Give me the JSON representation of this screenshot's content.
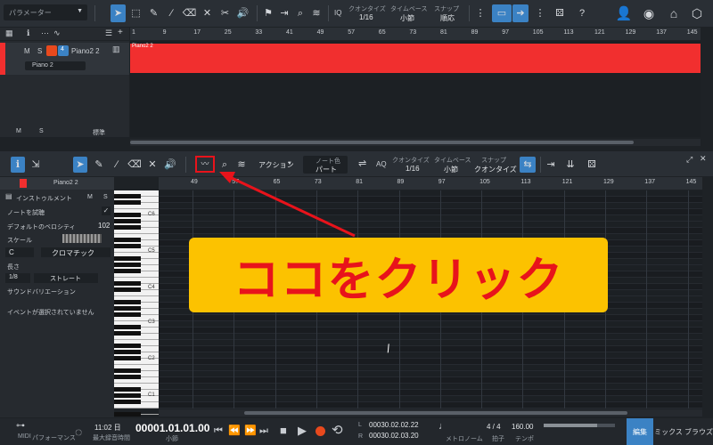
{
  "toolbar": {
    "params_label": "パラメーター",
    "quantize_label": "クオンタイズ",
    "quantize_value": "1/16",
    "timebase_label": "タイムベース",
    "timebase_value": "小節",
    "snap_label": "スナップ",
    "snap_value": "順応",
    "iq": "IQ",
    "help": "?"
  },
  "arrange": {
    "ruler": [
      "1",
      "9",
      "17",
      "25",
      "33",
      "41",
      "49",
      "57",
      "65",
      "73",
      "81",
      "89",
      "97",
      "105",
      "113",
      "121",
      "129",
      "137",
      "145"
    ],
    "track": {
      "m": "M",
      "s": "S",
      "num": "4",
      "name": "Piano2 2",
      "instrument": "Piano 2",
      "clip_name": "Piano2 2"
    },
    "footer": {
      "m": "M",
      "s": "S",
      "std": "標準"
    }
  },
  "editor": {
    "note_color_label": "ノート色",
    "note_color_value": "パート",
    "action_label": "アクション",
    "aq": "AQ",
    "quantize_label": "クオンタイズ",
    "quantize_value": "1/16",
    "timebase_label": "タイムベース",
    "timebase_value": "小節",
    "snap_label": "スナップ",
    "snap_value": "クオンタイズ",
    "ruler": [
      "49",
      "57",
      "65",
      "73",
      "81",
      "89",
      "97",
      "105",
      "113",
      "121",
      "129",
      "137",
      "145"
    ],
    "track_name": "Piano2 2",
    "inspector": {
      "instrument": "インストゥルメント",
      "m": "M",
      "s": "S",
      "audition": "ノートを試聴",
      "default_vel_label": "デフォルトのベロシティ",
      "default_vel_value": "102",
      "scale_label": "スケール",
      "scale_root": "C",
      "scale_value": "クロマチック",
      "length_label": "長さ",
      "length_value": "1/8",
      "length_mode": "ストレート",
      "sound_var": "サウンドバリエーション",
      "no_event": "イベントが選択されていません"
    },
    "keys": [
      "C6",
      "C5",
      "C4",
      "C3",
      "C2",
      "C1"
    ]
  },
  "annotation": {
    "text": "ココをクリック",
    "bg": "#fcc200",
    "fg": "#e8131b"
  },
  "transport": {
    "midi": "MIDI",
    "perf": "パフォーマンス",
    "time": "11:02 日",
    "time_sub": "最大録音時間",
    "position": "00001.01.01.00",
    "position_sub": "小節",
    "loop_l": "00030.02.02.22",
    "loop_r": "00030.02.03.20",
    "metronome": "メトロノーム",
    "sig": "4 / 4",
    "sig_sub": "拍子",
    "tempo": "160.00",
    "tempo_sub": "テンポ",
    "l": "L",
    "r": "R",
    "tabs": [
      "編集",
      "ミックス",
      "ブラウズ"
    ]
  },
  "colors": {
    "accent": "#3b82c4",
    "clip": "#f12f2f",
    "panel": "#2b3036"
  }
}
